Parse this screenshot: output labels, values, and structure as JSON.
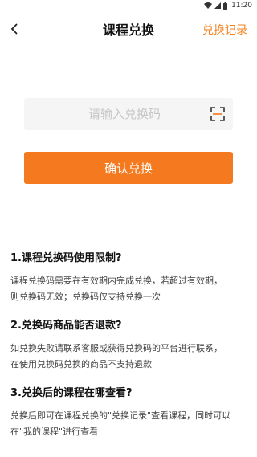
{
  "status_bar": {
    "time": "11:20",
    "icons": [
      "wifi-icon",
      "signal-icon",
      "battery-icon"
    ]
  },
  "header": {
    "title": "课程兑换",
    "record_label": "兑换记录",
    "back_icon": "chevron-left-icon"
  },
  "redeem": {
    "placeholder": "请输入兑换码",
    "value": "",
    "scan_icon": "scan-icon",
    "confirm_label": "确认兑换"
  },
  "colors": {
    "accent": "#F57A1F",
    "input_bg": "#f5f5f5"
  },
  "faq": [
    {
      "question": "1.课程兑换码使用限制?",
      "answer_lines": [
        "课程兑换码需要在有效期内完成兑换，若超过有效期，",
        "则兑换码无效；兑换码仅支持兑换一次"
      ]
    },
    {
      "question": "2.兑换码商品能否退款?",
      "answer_lines": [
        "如兑换失败请联系客服或获得兑换码的平台进行联系，",
        "在使用兑换码兑换的商品不支持退款"
      ]
    },
    {
      "question": "3.兑换后的课程在哪查看?",
      "answer_lines": [
        "兑换后即可在课程兑换的\"兑换记录\"查看课程，同时可以",
        "在\"我的课程\"进行查看"
      ]
    }
  ]
}
